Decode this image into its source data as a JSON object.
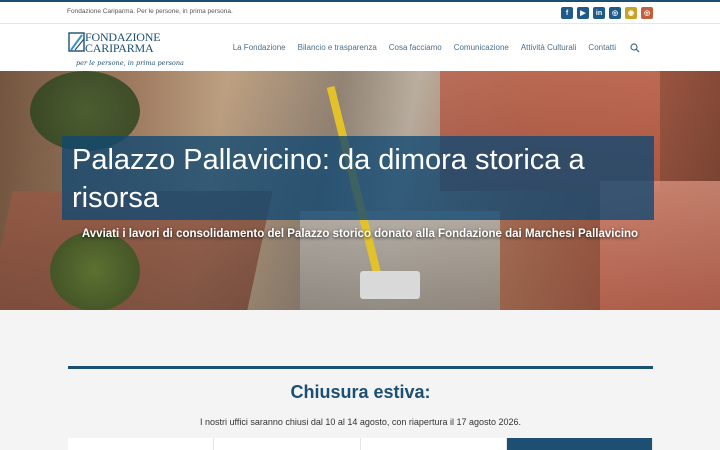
{
  "topbar": {
    "tagline": "Fondazione Cariparma. Per le persone, in prima persona.",
    "social": [
      {
        "icon": "facebook-icon",
        "glyph": "f",
        "color": "#1f5a8a"
      },
      {
        "icon": "youtube-icon",
        "glyph": "▶",
        "color": "#1f5a8a"
      },
      {
        "icon": "linkedin-icon",
        "glyph": "in",
        "color": "#1f5a8a"
      },
      {
        "icon": "instagram-icon",
        "glyph": "◎",
        "color": "#1f5a8a"
      },
      {
        "icon": "issuu-icon",
        "glyph": "◉",
        "color": "#c9a227"
      },
      {
        "icon": "instagram-alt-icon",
        "glyph": "◎",
        "color": "#c0603f"
      }
    ]
  },
  "header": {
    "logo": {
      "line1": "FONDAZIONE",
      "line2": "CARIPARMA",
      "motto": "per le persone, in prima persona"
    },
    "nav": [
      "La Fondazione",
      "Bilancio e trasparenza",
      "Cosa facciamo",
      "Comunicazione",
      "Attività Culturali",
      "Contatti"
    ]
  },
  "hero": {
    "title": "Palazzo Pallavicino: da dimora storica a risorsa",
    "subtitle": "Avviati i lavori di consolidamento del Palazzo storico donato alla Fondazione dai Marchesi Pallavicino"
  },
  "notice": {
    "title": "Chiusura estiva:",
    "text": "I nostri uffici saranno chiusi dal 10 al 14 agosto, con riapertura il 17 agosto 2026."
  },
  "colors": {
    "brand": "#1d4f73",
    "nav": "#4a6f8a"
  }
}
